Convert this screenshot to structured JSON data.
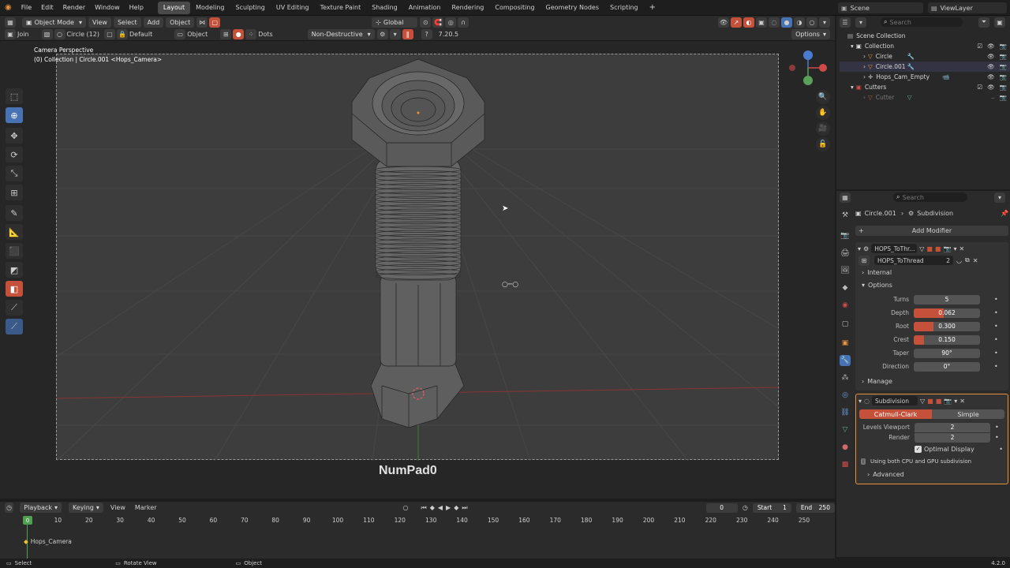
{
  "menubar": {
    "menus": [
      "File",
      "Edit",
      "Render",
      "Window",
      "Help"
    ],
    "workspaces": [
      "Layout",
      "Modeling",
      "Sculpting",
      "UV Editing",
      "Texture Paint",
      "Shading",
      "Animation",
      "Rendering",
      "Compositing",
      "Geometry Nodes",
      "Scripting"
    ],
    "active_workspace": "Layout",
    "add_workspace": "+",
    "scene": "Scene",
    "view_layer": "ViewLayer"
  },
  "viewport_header": {
    "mode": "Object Mode",
    "menus": [
      "View",
      "Select",
      "Add",
      "Object"
    ],
    "transform_orientation": "Global"
  },
  "tool_options": {
    "join": "Join",
    "shape": "Circle (12)",
    "default": "Default",
    "object": "Object",
    "dots": "Dots",
    "non_destructive": "Non-Destructive",
    "version": "7.20.5",
    "options": "Options"
  },
  "viewport": {
    "perspective": "Camera Perspective",
    "collection_info": "(0) Collection | Circle.001 <Hops_Camera>",
    "key_hint": "NumPad0"
  },
  "outliner": {
    "search_placeholder": "Search",
    "scene_collection": "Scene Collection",
    "items": [
      {
        "name": "Collection",
        "indent": 1
      },
      {
        "name": "Circle",
        "indent": 2
      },
      {
        "name": "Circle.001",
        "indent": 2
      },
      {
        "name": "Hops_Cam_Empty",
        "indent": 2
      },
      {
        "name": "Cutters",
        "indent": 1
      },
      {
        "name": "Cutter",
        "indent": 2
      }
    ]
  },
  "properties": {
    "search_placeholder": "Search",
    "breadcrumb_object": "Circle.001",
    "breadcrumb_modifier": "Subdivision",
    "add_modifier": "Add Modifier",
    "mod1_name": "HOPS_ToThr...",
    "nodegroup": "HOPS_ToThread",
    "nodegroup_users": "2",
    "internal": "Internal",
    "options": "Options",
    "fields": [
      {
        "label": "Turns",
        "value": "5",
        "fill": 0
      },
      {
        "label": "Depth",
        "value": "0.062",
        "fill": 0.45
      },
      {
        "label": "Root",
        "value": "0.300",
        "fill": 0.3
      },
      {
        "label": "Crest",
        "value": "0.150",
        "fill": 0.15
      },
      {
        "label": "Taper",
        "value": "90°",
        "fill": 0
      },
      {
        "label": "Direction",
        "value": "0°",
        "fill": 0
      }
    ],
    "manage": "Manage",
    "mod2_name": "Subdivision",
    "catmull": "Catmull-Clark",
    "simple": "Simple",
    "levels_viewport_label": "Levels Viewport",
    "levels_viewport": "2",
    "render_label": "Render",
    "render_value": "2",
    "optimal_display": "Optimal Display",
    "info": "Using both CPU and GPU subdivision",
    "advanced": "Advanced"
  },
  "timeline": {
    "playback": "Playback",
    "keying": "Keying",
    "view": "View",
    "marker": "Marker",
    "current_frame": "0",
    "start_label": "Start",
    "start": "1",
    "end_label": "End",
    "end": "250",
    "ticks": [
      "0",
      "10",
      "20",
      "30",
      "40",
      "50",
      "60",
      "70",
      "80",
      "90",
      "100",
      "110",
      "120",
      "130",
      "140",
      "150",
      "160",
      "170",
      "180",
      "190",
      "200",
      "210",
      "220",
      "230",
      "240",
      "250"
    ],
    "track_label": "Hops_Camera"
  },
  "statusbar": {
    "select": "Select",
    "rotate_view": "Rotate View",
    "object": "Object",
    "version": "4.2.0"
  },
  "colors": {
    "accent": "#4772b3",
    "hops": "#c6513a",
    "selected": "#e8903e"
  }
}
